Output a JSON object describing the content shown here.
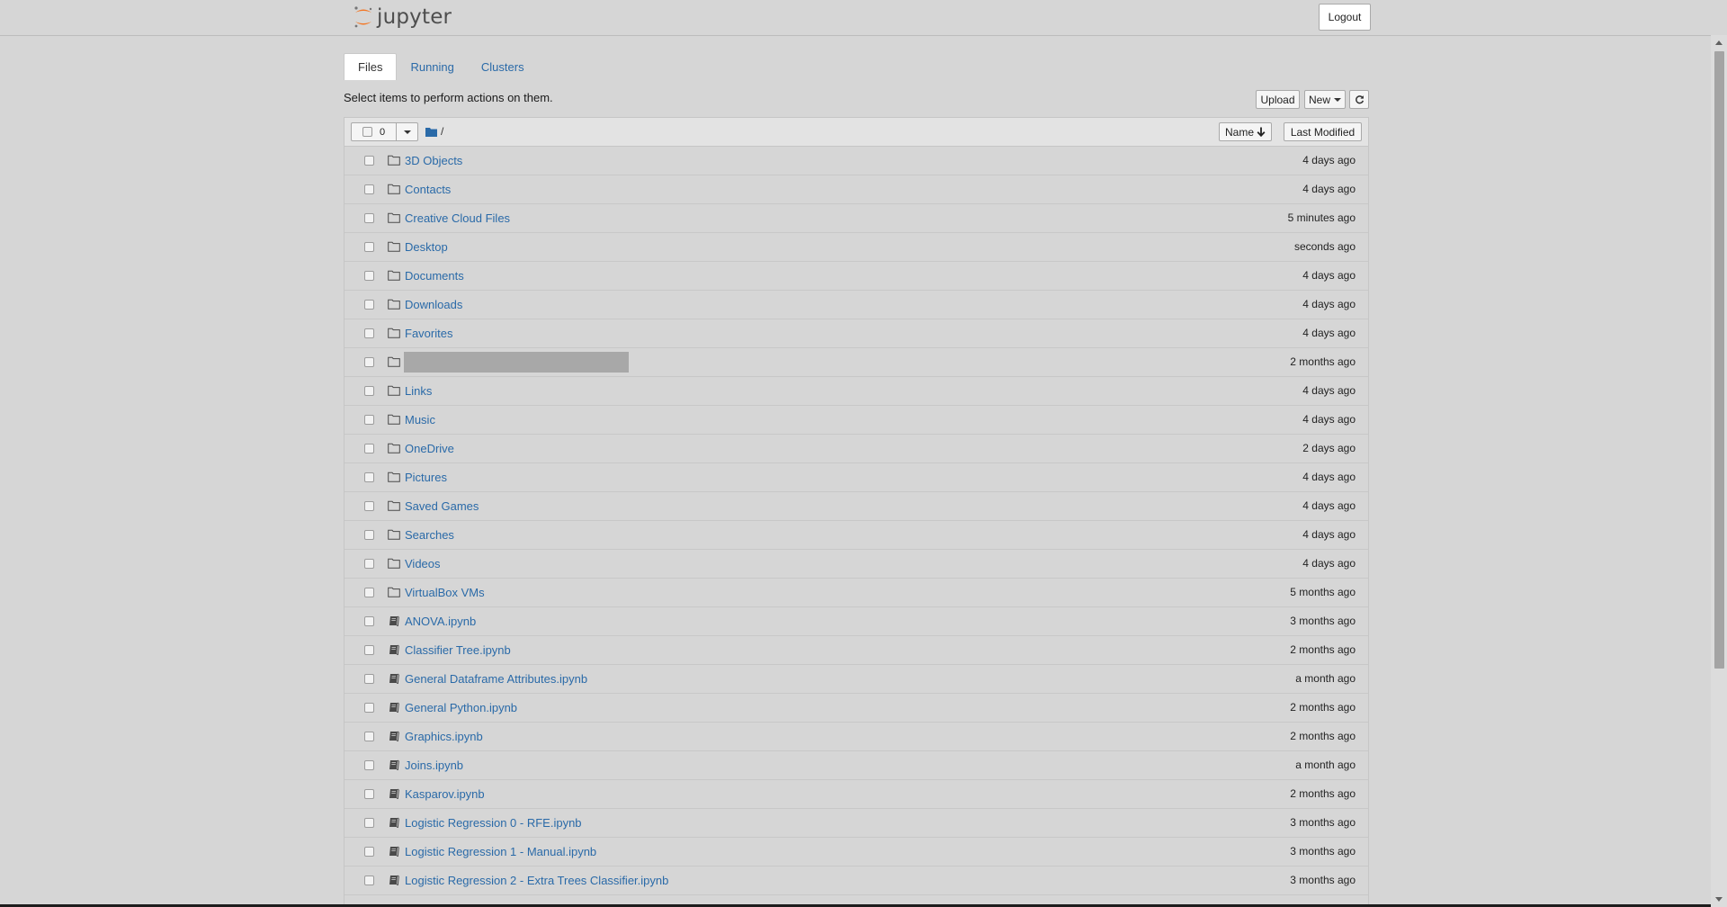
{
  "header": {
    "logo_text": "jupyter",
    "logout_label": "Logout"
  },
  "tabs": [
    {
      "label": "Files",
      "active": true
    },
    {
      "label": "Running",
      "active": false
    },
    {
      "label": "Clusters",
      "active": false
    }
  ],
  "toolbar": {
    "select_hint": "Select items to perform actions on them.",
    "upload_label": "Upload",
    "new_label": "New",
    "refresh_icon": "refresh-icon"
  },
  "list_header": {
    "selected_count": "0",
    "breadcrumb_icon": "folder-icon",
    "breadcrumb_path": "/",
    "sort_name_label": "Name",
    "sort_name_icon": "arrow-down-icon",
    "sort_modified_label": "Last Modified"
  },
  "rows": [
    {
      "type": "folder",
      "name": "3D Objects",
      "modified": "4 days ago"
    },
    {
      "type": "folder",
      "name": "Contacts",
      "modified": "4 days ago"
    },
    {
      "type": "folder",
      "name": "Creative Cloud Files",
      "modified": "5 minutes ago"
    },
    {
      "type": "folder",
      "name": "Desktop",
      "modified": "seconds ago"
    },
    {
      "type": "folder",
      "name": "Documents",
      "modified": "4 days ago"
    },
    {
      "type": "folder",
      "name": "Downloads",
      "modified": "4 days ago"
    },
    {
      "type": "folder",
      "name": "Favorites",
      "modified": "4 days ago"
    },
    {
      "type": "folder",
      "name": "",
      "redacted": true,
      "modified": "2 months ago"
    },
    {
      "type": "folder",
      "name": "Links",
      "modified": "4 days ago"
    },
    {
      "type": "folder",
      "name": "Music",
      "modified": "4 days ago"
    },
    {
      "type": "folder",
      "name": "OneDrive",
      "modified": "2 days ago"
    },
    {
      "type": "folder",
      "name": "Pictures",
      "modified": "4 days ago"
    },
    {
      "type": "folder",
      "name": "Saved Games",
      "modified": "4 days ago"
    },
    {
      "type": "folder",
      "name": "Searches",
      "modified": "4 days ago"
    },
    {
      "type": "folder",
      "name": "Videos",
      "modified": "4 days ago"
    },
    {
      "type": "folder",
      "name": "VirtualBox VMs",
      "modified": "5 months ago"
    },
    {
      "type": "notebook",
      "name": "ANOVA.ipynb",
      "modified": "3 months ago"
    },
    {
      "type": "notebook",
      "name": "Classifier Tree.ipynb",
      "modified": "2 months ago"
    },
    {
      "type": "notebook",
      "name": "General Dataframe Attributes.ipynb",
      "modified": "a month ago"
    },
    {
      "type": "notebook",
      "name": "General Python.ipynb",
      "modified": "2 months ago"
    },
    {
      "type": "notebook",
      "name": "Graphics.ipynb",
      "modified": "2 months ago"
    },
    {
      "type": "notebook",
      "name": "Joins.ipynb",
      "modified": "a month ago"
    },
    {
      "type": "notebook",
      "name": "Kasparov.ipynb",
      "modified": "2 months ago"
    },
    {
      "type": "notebook",
      "name": "Logistic Regression 0 - RFE.ipynb",
      "modified": "3 months ago"
    },
    {
      "type": "notebook",
      "name": "Logistic Regression 1 - Manual.ipynb",
      "modified": "3 months ago"
    },
    {
      "type": "notebook",
      "name": "Logistic Regression 2 - Extra Trees Classifier.ipynb",
      "modified": "3 months ago"
    }
  ],
  "colors": {
    "background": "#d6d6d6",
    "link": "#2a6aa8",
    "logo_orange": "#f37726"
  }
}
